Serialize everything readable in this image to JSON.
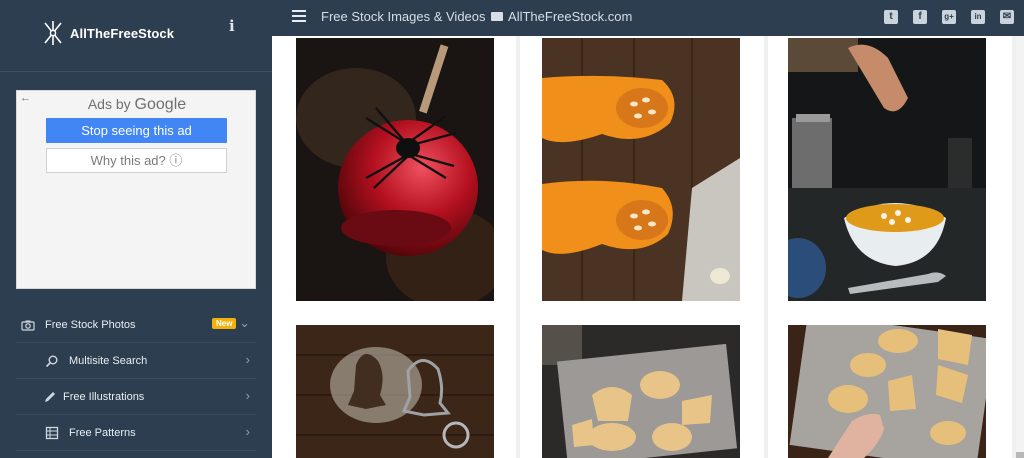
{
  "brand": {
    "name": "AllTheFreeStock",
    "info_icon": "info-icon"
  },
  "ad": {
    "back_arrow": "←",
    "ads_by": "Ads by",
    "google": "Google",
    "stop_label": "Stop seeing this ad",
    "why_label": "Why this ad? ⓘ"
  },
  "sidebar": {
    "items": [
      {
        "label": "Free Stock Photos",
        "icon": "camera-icon",
        "badge": "New",
        "chevron": "⌄"
      },
      {
        "label": "Multisite Search",
        "icon": "search-icon",
        "chevron": "›"
      },
      {
        "label": "Free Illustrations",
        "icon": "pencil-icon",
        "chevron": "›"
      },
      {
        "label": "Free Patterns",
        "icon": "pattern-icon",
        "chevron": "›"
      }
    ]
  },
  "topbar": {
    "title_left": "Free Stock Images & Videos",
    "title_right": "AllTheFreeStock.com",
    "socials": [
      {
        "icon": "twitter-icon",
        "glyph": "t"
      },
      {
        "icon": "facebook-icon",
        "glyph": "f"
      },
      {
        "icon": "google-plus-icon",
        "glyph": "g+"
      },
      {
        "icon": "linkedin-icon",
        "glyph": "in"
      },
      {
        "icon": "email-icon",
        "glyph": "✉"
      }
    ]
  },
  "gallery": {
    "photos": [
      {
        "name": "photo-candy-apple-spider"
      },
      {
        "name": "photo-butternut-squash"
      },
      {
        "name": "photo-pumpkin-soup"
      },
      {
        "name": "photo-flour-ghost-cutter"
      },
      {
        "name": "photo-halloween-cookies-tray"
      },
      {
        "name": "photo-hand-cookies"
      }
    ]
  },
  "colors": {
    "sidebar_bg": "#2d3e50",
    "ad_button": "#4285f4",
    "new_badge": "#f2b10d"
  }
}
